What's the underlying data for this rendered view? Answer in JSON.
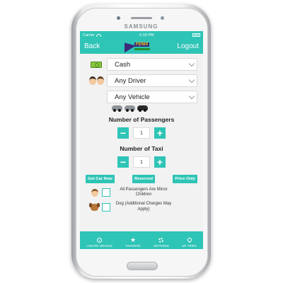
{
  "device": {
    "brand": "SAMSUNG"
  },
  "status_bar": {
    "carrier": "Carrier",
    "time": "5:16 PM"
  },
  "header": {
    "back_label": "Back",
    "logout_label": "Logout",
    "logo_text": "FENIX"
  },
  "form": {
    "payment": {
      "value": "Cash",
      "icon": "cash-icon"
    },
    "driver": {
      "value": "Any Driver",
      "icon": "driver-faces-icon"
    },
    "vehicle": {
      "value": "Any Vehicle",
      "icon": "vehicle-icons"
    }
  },
  "passengers": {
    "title": "Number of Passengers",
    "value": "1"
  },
  "taxi": {
    "title": "Number of Taxi",
    "value": "1"
  },
  "actions": {
    "get_car_now": "Get Car Now",
    "reserved": "Reserved",
    "price_only": "Price Only"
  },
  "options": {
    "minor_children": "All Passengers Are Minor Children",
    "dog": "Dog (Additional Charges May Apply)"
  },
  "tabs": [
    {
      "label": "LOCATE VEHICLE",
      "icon": "locate-icon"
    },
    {
      "label": "FAVORITE",
      "icon": "star-icon"
    },
    {
      "label": "SETTINGS",
      "icon": "gear-icon"
    },
    {
      "label": "MY TRIPS",
      "icon": "pin-icon"
    }
  ],
  "colors": {
    "accent": "#2ec4b6",
    "background": "#f2f2f2"
  }
}
